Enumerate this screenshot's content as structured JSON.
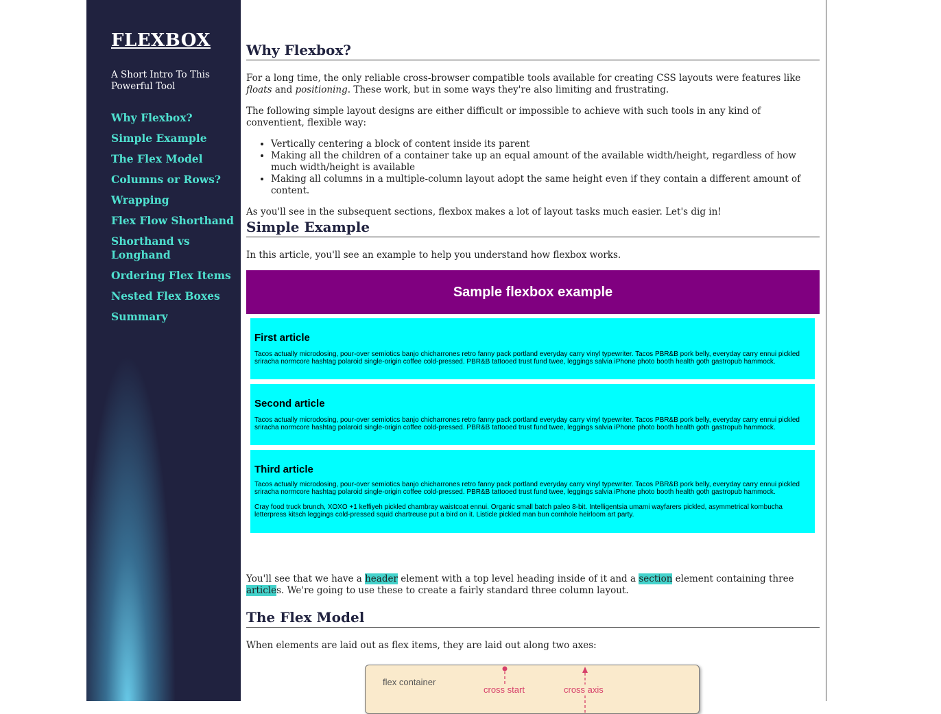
{
  "sidebar": {
    "logo": "FLEXBOX",
    "tagline": "A Short Intro To This Powerful Tool",
    "nav": [
      {
        "label": "Why Flexbox?"
      },
      {
        "label": "Simple Example"
      },
      {
        "label": "The Flex Model"
      },
      {
        "label": "Columns or Rows?"
      },
      {
        "label": "Wrapping"
      },
      {
        "label": "Flex Flow Shorthand"
      },
      {
        "label": "Shorthand vs Longhand"
      },
      {
        "label": "Ordering Flex Items"
      },
      {
        "label": "Nested Flex Boxes"
      },
      {
        "label": "Summary"
      }
    ]
  },
  "why": {
    "title": "Why Flexbox?",
    "p1_a": "For a long time, the only reliable cross-browser compatible tools available for creating CSS layouts were features like ",
    "p1_floats": "floats",
    "p1_and": " and ",
    "p1_positioning": "positioning",
    "p1_b": ". These work, but in some ways they're also limiting and frustrating.",
    "p2": "The following simple layout designs are either difficult or impossible to achieve with such tools in any kind of conventient, flexible way:",
    "bullets": [
      "Vertically centering a block of content inside its parent",
      "Making all the children of a container take up an equal amount of the available width/height, regardless of how much width/height is available",
      "Making all columns in a multiple-column layout adopt the same height even if they contain a different amount of content."
    ],
    "p3": "As you'll see in the subsequent sections, flexbox makes a lot of layout tasks much easier. Let's dig in!"
  },
  "simple": {
    "title": "Simple Example",
    "intro": "In this article, you'll see an example to help you understand how flexbox works.",
    "sample_heading": "Sample flexbox example",
    "articles": [
      {
        "title": "First article",
        "paras": [
          "Tacos actually microdosing, pour-over semiotics banjo chicharrones retro fanny pack portland everyday carry vinyl typewriter. Tacos PBR&B pork belly, everyday carry ennui pickled sriracha normcore hashtag polaroid single-origin coffee cold-pressed. PBR&B tattooed trust fund twee, leggings salvia iPhone photo booth health goth gastropub hammock."
        ]
      },
      {
        "title": "Second article",
        "paras": [
          "Tacos actually microdosing, pour-over semiotics banjo chicharrones retro fanny pack portland everyday carry vinyl typewriter. Tacos PBR&B pork belly, everyday carry ennui pickled sriracha normcore hashtag polaroid single-origin coffee cold-pressed. PBR&B tattooed trust fund twee, leggings salvia iPhone photo booth health goth gastropub hammock."
        ]
      },
      {
        "title": "Third article",
        "paras": [
          "Tacos actually microdosing, pour-over semiotics banjo chicharrones retro fanny pack portland everyday carry vinyl typewriter. Tacos PBR&B pork belly, everyday carry ennui pickled sriracha normcore hashtag polaroid single-origin coffee cold-pressed. PBR&B tattooed trust fund twee, leggings salvia iPhone photo booth health goth gastropub hammock.",
          "Cray food truck brunch, XOXO +1 keffiyeh pickled chambray waistcoat ennui. Organic small batch paleo 8-bit. Intelligentsia umami wayfarers pickled, asymmetrical kombucha letterpress kitsch leggings cold-pressed squid chartreuse put a bird on it. Listicle pickled man bun cornhole heirloom art party."
        ]
      }
    ],
    "after_a": "You'll see that we have a ",
    "after_header": "header",
    "after_b": " element with a top level heading inside of it and a ",
    "after_section": "section",
    "after_c": " element containing three ",
    "after_article": "article",
    "after_d": "s. We're going to use these to create a fairly standard three column layout."
  },
  "model": {
    "title": "The Flex Model",
    "intro": "When elements are laid out as flex items, they are laid out along two axes:",
    "diagram": {
      "container_label": "flex container",
      "cross_start": "cross start",
      "cross_axis": "cross axis"
    }
  },
  "colors": {
    "sidebar_bg": "#20223f",
    "nav_link": "#4fe0cf",
    "sample_header": "#800080",
    "article_bg": "#00ffff",
    "code_highlight": "#44d2cb"
  }
}
